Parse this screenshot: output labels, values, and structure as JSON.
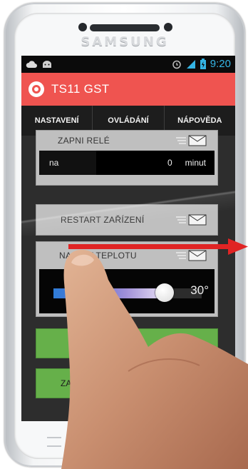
{
  "device": {
    "brand": "SAMSUNG"
  },
  "status_bar": {
    "time": "9:20"
  },
  "app": {
    "title": "TS11 GST"
  },
  "tabs": [
    {
      "label": "NASTAVENÍ",
      "active": false
    },
    {
      "label": "OVLÁDÁNÍ",
      "active": true
    },
    {
      "label": "NÁPOVĚDA",
      "active": false
    }
  ],
  "relay_card": {
    "title": "ZAPNI RELÉ",
    "timer_label": "na",
    "timer_value": "0",
    "timer_unit": "minut"
  },
  "restart_card": {
    "title": "RESTART ZAŘÍZENÍ"
  },
  "temperature_card": {
    "title": "NASTAV TEPLOTU",
    "value_label": "30°",
    "slider_fraction": 0.75
  },
  "green_buttons": [
    {
      "label": ""
    },
    {
      "label": "ZAPNI VŠECH"
    }
  ],
  "colors": {
    "accent": "#ef5450",
    "status_time": "#35b5e5",
    "button_green": "#66b04a",
    "gesture_arrow": "#e02424"
  }
}
